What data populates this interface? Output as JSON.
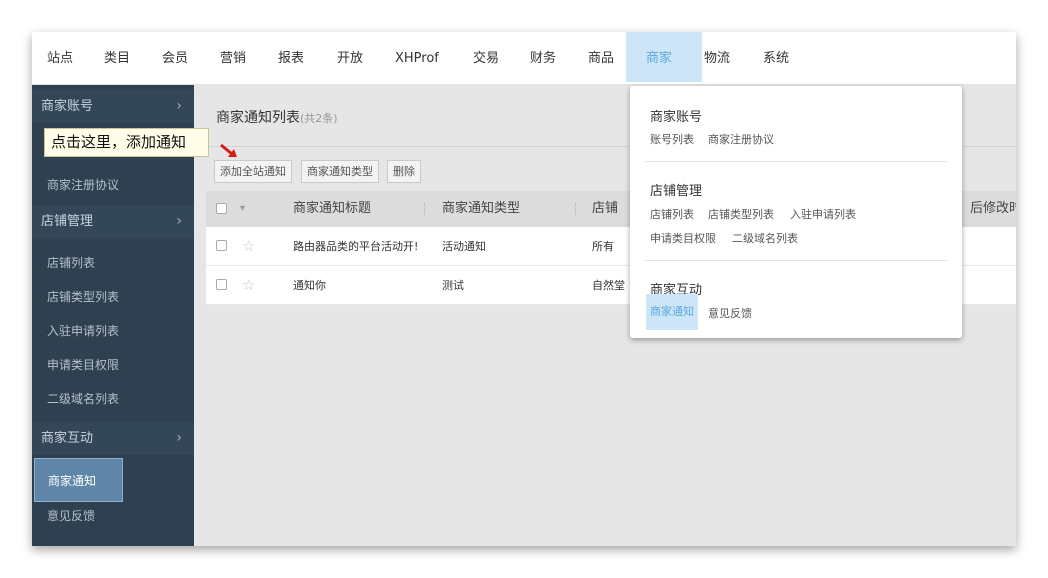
{
  "topnav": {
    "items": [
      "站点",
      "类目",
      "会员",
      "营销",
      "报表",
      "开放",
      "XHProf",
      "交易",
      "财务",
      "商品",
      "商家",
      "物流",
      "系统"
    ],
    "active": "商家"
  },
  "sidebar": {
    "section1": "商家账号",
    "section1_item": "商家注册协议",
    "section2": "店铺管理",
    "section2_items": [
      "店铺列表",
      "店铺类型列表",
      "入驻申请列表",
      "申请类目权限",
      "二级域名列表"
    ],
    "section3": "商家互动",
    "section3_items": [
      "商家通知",
      "意见反馈"
    ],
    "chevron": "›"
  },
  "tooltip": "点击这里，添加通知",
  "main": {
    "title": "商家通知列表",
    "count": "(共2条)",
    "buttons": [
      "添加全站通知",
      "商家通知类型",
      "删除"
    ],
    "columns": [
      "商家通知标题",
      "商家通知类型",
      "店铺",
      "后修改时间"
    ],
    "rows": [
      {
        "title": "路由器品类的平台活动开!",
        "type": "活动通知",
        "store": "所有"
      },
      {
        "title": "通知你",
        "type": "测试",
        "store": "自然堂"
      }
    ]
  },
  "dropdown": {
    "groups": [
      {
        "title": "商家账号",
        "links": [
          "账号列表",
          "商家注册协议"
        ]
      },
      {
        "title": "店铺管理",
        "links": [
          "店铺列表",
          "店铺类型列表",
          "入驻申请列表",
          "申请类目权限",
          "二级域名列表"
        ]
      },
      {
        "title": "商家互动",
        "links": [
          "商家通知",
          "意见反馈"
        ]
      }
    ]
  },
  "colors": {
    "accent": "#5aa8e0",
    "sidebar": "#2f4050",
    "active_tab_bg": "#cde6f7"
  }
}
